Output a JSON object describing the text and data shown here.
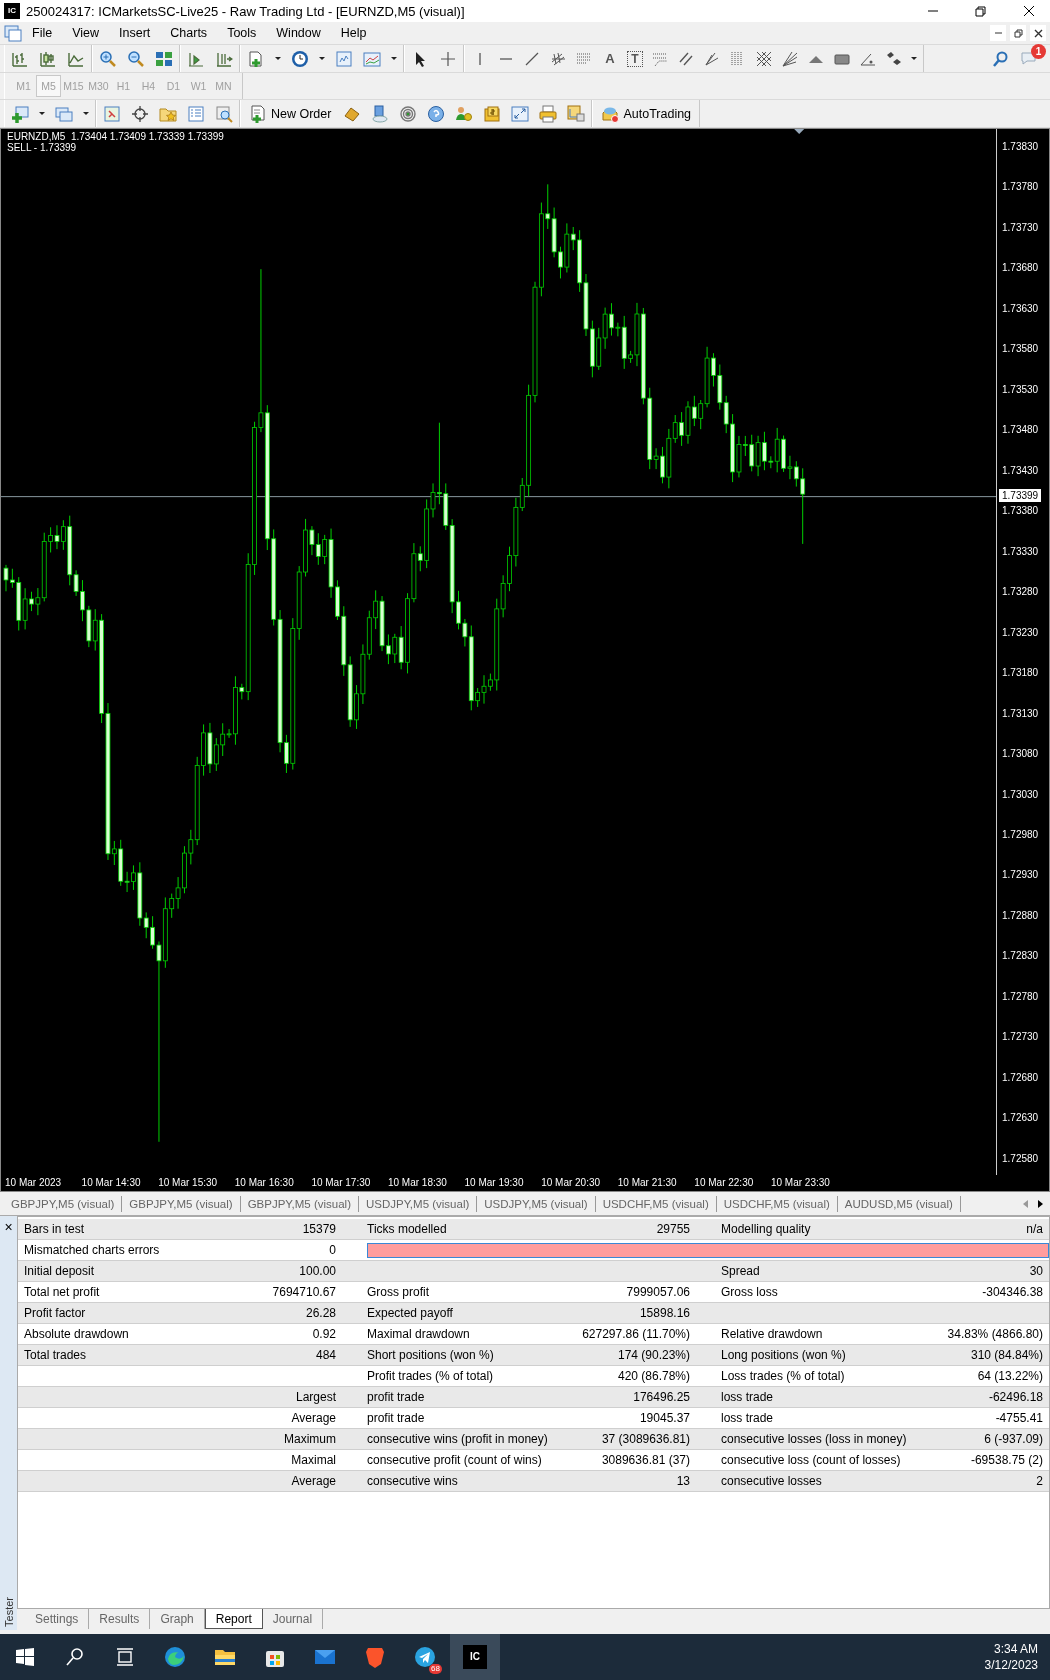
{
  "window": {
    "title": "250024317: ICMarketsSC-Live25 - Raw Trading Ltd - [EURNZD,M5 (visual)]",
    "logo_text": "IC"
  },
  "menu": [
    "File",
    "View",
    "Insert",
    "Charts",
    "Tools",
    "Window",
    "Help"
  ],
  "drawing_tools": {
    "text_glyph": "A",
    "label_glyph": "T"
  },
  "notifications": {
    "badge": "1"
  },
  "timeframes": [
    {
      "label": "M1",
      "selected": false,
      "disabled": true
    },
    {
      "label": "M5",
      "selected": true,
      "disabled": true
    },
    {
      "label": "M15",
      "selected": false,
      "disabled": true
    },
    {
      "label": "M30",
      "selected": false,
      "disabled": true
    },
    {
      "label": "H1",
      "selected": false,
      "disabled": true
    },
    {
      "label": "H4",
      "selected": false,
      "disabled": true
    },
    {
      "label": "D1",
      "selected": false,
      "disabled": true
    },
    {
      "label": "W1",
      "selected": false,
      "disabled": true
    },
    {
      "label": "MN",
      "selected": false,
      "disabled": true
    }
  ],
  "trade_toolbar": {
    "new_order": "New Order",
    "auto_trading": "AutoTrading"
  },
  "chart": {
    "header": "EURNZD,M5  1.73404 1.73409 1.73339 1.73399",
    "order_line": "SELL - 1.73399",
    "price_scale": [
      "1.73830",
      "1.73780",
      "1.73730",
      "1.73680",
      "1.73630",
      "1.73580",
      "1.73530",
      "1.73480",
      "1.73430",
      "1.73380",
      "1.73330",
      "1.73280",
      "1.73230",
      "1.73180",
      "1.73130",
      "1.73080",
      "1.73030",
      "1.72980",
      "1.72930",
      "1.72880",
      "1.72830",
      "1.72780",
      "1.72730",
      "1.72680",
      "1.72630",
      "1.72580"
    ],
    "current_price": "1.73399",
    "time_scale": [
      "10 Mar 2023",
      "10 Mar 14:30",
      "10 Mar 15:30",
      "10 Mar 16:30",
      "10 Mar 17:30",
      "10 Mar 18:30",
      "10 Mar 19:30",
      "10 Mar 20:30",
      "10 Mar 21:30",
      "10 Mar 22:30",
      "10 Mar 23:30"
    ]
  },
  "chart_tabs": [
    "GBPJPY,M5 (visual)",
    "GBPJPY,M5 (visual)",
    "GBPJPY,M5 (visual)",
    "USDJPY,M5 (visual)",
    "USDJPY,M5 (visual)",
    "USDCHF,M5 (visual)",
    "USDCHF,M5 (visual)",
    "AUDUSD,M5 (visual)"
  ],
  "tester": {
    "close_glyph": "×",
    "side_label": "Tester",
    "report": [
      {
        "kind": "stats",
        "cells": [
          "Bars in test",
          "15379",
          "Ticks modelled",
          "29755",
          "Modelling quality",
          "n/a"
        ]
      },
      {
        "kind": "quality_bar",
        "cells": [
          "Mismatched charts errors",
          "0"
        ]
      },
      {
        "kind": "stats",
        "cells": [
          "Initial deposit",
          "100.00",
          null,
          null,
          "Spread",
          "30"
        ]
      },
      {
        "kind": "stats",
        "cells": [
          "Total net profit",
          "7694710.67",
          "Gross profit",
          "7999057.06",
          "Gross loss",
          "-304346.38"
        ]
      },
      {
        "kind": "stats",
        "cells": [
          "Profit factor",
          "26.28",
          "Expected payoff",
          "15898.16",
          null,
          null
        ]
      },
      {
        "kind": "stats",
        "cells": [
          "Absolute drawdown",
          "0.92",
          "Maximal drawdown",
          "627297.86 (11.70%)",
          "Relative drawdown",
          "34.83% (4866.80)"
        ]
      },
      {
        "kind": "stats",
        "cells": [
          "Total trades",
          "484",
          "Short positions (won %)",
          "174 (90.23%)",
          "Long positions (won %)",
          "310 (84.84%)"
        ]
      },
      {
        "kind": "stats",
        "cells": [
          null,
          null,
          "Profit trades (% of total)",
          "420 (86.78%)",
          "Loss trades (% of total)",
          "64 (13.22%)"
        ]
      },
      {
        "kind": "stats",
        "cells": [
          null,
          "Largest",
          "profit trade",
          "176496.25",
          "loss trade",
          "-62496.18"
        ]
      },
      {
        "kind": "stats",
        "cells": [
          null,
          "Average",
          "profit trade",
          "19045.37",
          "loss trade",
          "-4755.41"
        ]
      },
      {
        "kind": "stats",
        "cells": [
          null,
          "Maximum",
          "consecutive wins (profit in money)",
          "37 (3089636.81)",
          "consecutive losses (loss in money)",
          "6 (-937.09)"
        ]
      },
      {
        "kind": "stats",
        "cells": [
          null,
          "Maximal",
          "consecutive profit (count of wins)",
          "3089636.81 (37)",
          "consecutive loss (count of losses)",
          "-69538.75 (2)"
        ]
      },
      {
        "kind": "stats",
        "cells": [
          null,
          "Average",
          "consecutive wins",
          "13",
          "consecutive losses",
          "2"
        ]
      }
    ],
    "tabs": [
      {
        "label": "Settings",
        "selected": false
      },
      {
        "label": "Results",
        "selected": false
      },
      {
        "label": "Graph",
        "selected": false
      },
      {
        "label": "Report",
        "selected": true
      },
      {
        "label": "Journal",
        "selected": false
      }
    ]
  },
  "taskbar": {
    "telegram_badge": "68",
    "app_logo_text": "IC",
    "time": "3:34 AM",
    "date": "3/12/2023"
  }
}
